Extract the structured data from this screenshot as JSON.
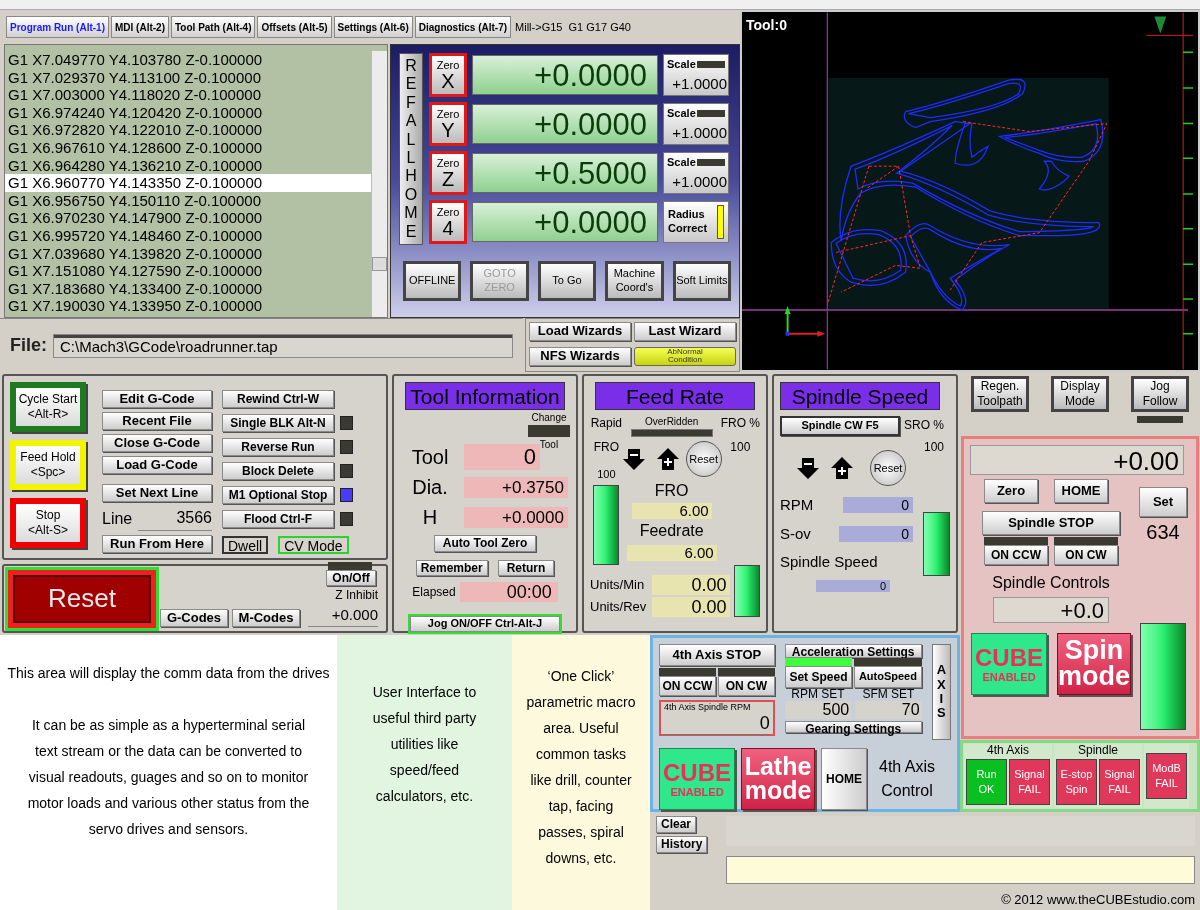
{
  "tabs": [
    {
      "label": "Program Run (Alt-1)",
      "selected": true
    },
    {
      "label": "MDI (Alt-2)",
      "selected": false
    },
    {
      "label": "Tool Path (Alt-4)",
      "selected": false
    },
    {
      "label": "Offsets (Alt-5)",
      "selected": false
    },
    {
      "label": "Settings (Alt-6)",
      "selected": false
    },
    {
      "label": "Diagnostics (Alt-7)",
      "selected": false
    }
  ],
  "modal_status": "Mill->G15  G1 G17 G40",
  "gcode": {
    "lines": [
      {
        "text": "G1 X7.049770 Y4.103780 Z-0.100000",
        "selected": false
      },
      {
        "text": "G1 X7.029370 Y4.113100 Z-0.100000",
        "selected": false
      },
      {
        "text": "G1 X7.003000 Y4.118020 Z-0.100000",
        "selected": false
      },
      {
        "text": "G1 X6.974240 Y4.120420 Z-0.100000",
        "selected": false
      },
      {
        "text": "G1 X6.972820 Y4.122010 Z-0.100000",
        "selected": false
      },
      {
        "text": "G1 X6.967610 Y4.128600 Z-0.100000",
        "selected": false
      },
      {
        "text": "G1 X6.964280 Y4.136210 Z-0.100000",
        "selected": false
      },
      {
        "text": "G1 X6.960770 Y4.143350 Z-0.100000",
        "selected": true
      },
      {
        "text": "G1 X6.956750 Y4.150110 Z-0.100000",
        "selected": false
      },
      {
        "text": "G1 X6.970230 Y4.147900 Z-0.100000",
        "selected": false
      },
      {
        "text": "G1 X6.995720 Y4.148460 Z-0.100000",
        "selected": false
      },
      {
        "text": "G1 X7.039680 Y4.139820 Z-0.100000",
        "selected": false
      },
      {
        "text": "G1 X7.151080 Y4.127590 Z-0.100000",
        "selected": false
      },
      {
        "text": "G1 X7.183680 Y4.133400 Z-0.100000",
        "selected": false
      },
      {
        "text": "G1 X7.190030 Y4.133950 Z-0.100000",
        "selected": false
      }
    ]
  },
  "dro": {
    "ref_label": "REF ALL HOME",
    "axes": [
      {
        "zero": "Zero",
        "axis": "X",
        "value": "+0.0000",
        "side": {
          "kind": "scale",
          "label": "Scale",
          "value": "+1.0000",
          "on": false
        }
      },
      {
        "zero": "Zero",
        "axis": "Y",
        "value": "+0.0000",
        "side": {
          "kind": "scale",
          "label": "Scale",
          "value": "+1.0000",
          "on": false
        }
      },
      {
        "zero": "Zero",
        "axis": "Z",
        "value": "+0.5000",
        "side": {
          "kind": "scale",
          "label": "Scale",
          "value": "+1.0000",
          "on": false
        }
      },
      {
        "zero": "Zero",
        "axis": "4",
        "value": "+0.0000",
        "side": {
          "kind": "toggle",
          "label": "Radius Correct",
          "on": true
        }
      }
    ],
    "buttons": [
      {
        "label": "OFFLINE",
        "disabled": false
      },
      {
        "label": "GOTO ZERO",
        "disabled": true
      },
      {
        "label": "To Go",
        "disabled": false
      },
      {
        "label": "Machine Coord's",
        "disabled": false
      },
      {
        "label": "Soft Limits",
        "disabled": false
      }
    ]
  },
  "file": {
    "label": "File:",
    "path": "C:\\Mach3\\GCode\\roadrunner.tap"
  },
  "wizards": [
    {
      "kind": "button",
      "label": "Load Wizards"
    },
    {
      "kind": "button",
      "label": "Last Wizard"
    },
    {
      "kind": "button",
      "label": "NFS Wizards"
    },
    {
      "kind": "alarm",
      "label": "AbNormal Condition"
    }
  ],
  "toolpath": {
    "label": "Tool:0"
  },
  "cycle_buttons": [
    {
      "label": "Cycle Start\n<Alt-R>",
      "color": "#1e7a1e"
    },
    {
      "label": "Feed Hold\n<Spc>",
      "color": "#f4f400"
    },
    {
      "label": "Stop\n<Alt-S>",
      "color": "#f00000"
    }
  ],
  "file_buttons": [
    "Edit G-Code",
    "Recent File",
    "Close G-Code",
    "Load G-Code",
    "Set Next Line"
  ],
  "line": {
    "label": "Line",
    "value": "3566"
  },
  "run_from_here": "Run From Here",
  "toggles": [
    {
      "kind": "plain",
      "label": "Rewind Ctrl-W"
    },
    {
      "kind": "led",
      "label": "Single BLK Alt-N",
      "on": false
    },
    {
      "kind": "led",
      "label": "Reverse Run",
      "on": false
    },
    {
      "kind": "led",
      "label": "Block Delete",
      "on": false
    },
    {
      "kind": "led",
      "label": "M1 Optional Stop",
      "on": true
    },
    {
      "kind": "led",
      "label": "Flood Ctrl-F",
      "on": false
    }
  ],
  "modes": [
    {
      "label": "Dwell",
      "on": false
    },
    {
      "label": "CV Mode",
      "on": true
    }
  ],
  "reset": {
    "label": "Reset"
  },
  "code_lists": [
    "G-Codes",
    "M-Codes"
  ],
  "z_inhibit": {
    "button": "On/Off",
    "on": false,
    "label": "Z Inhibit",
    "value": "+0.000"
  },
  "tool_info": {
    "title": "Tool Information",
    "change_top": "Change",
    "change_bottom": "Tool",
    "change_on": false,
    "fields": [
      {
        "label": "Tool",
        "value": "0"
      },
      {
        "label": "Dia.",
        "value": "+0.3750"
      },
      {
        "label": "H",
        "value": "+0.0000"
      }
    ],
    "auto_zero": "Auto Tool Zero",
    "remember": "Remember",
    "return": "Return",
    "elapsed_label": "Elapsed",
    "elapsed": "00:00",
    "jog": "Jog ON/OFF Ctrl-Alt-J"
  },
  "feed_rate": {
    "title": "Feed Rate",
    "rapid": "Rapid",
    "fro_small": "FRO",
    "overridden": "OverRidden",
    "overridden_on": false,
    "fro_pct_label": "FRO %",
    "fro_pct": "100",
    "slider_label": "100",
    "reset": "Reset",
    "fro_label": "FRO",
    "fro_value": "6.00",
    "feedrate_label": "Feedrate",
    "feedrate_value": "6.00",
    "units_min_label": "Units/Min",
    "units_min": "0.00",
    "units_rev_label": "Units/Rev",
    "units_rev": "0.00"
  },
  "spindle_speed": {
    "title": "Spindle Speed",
    "cw_button": "Spindle CW F5",
    "sro_label": "SRO %",
    "sro": "100",
    "reset": "Reset",
    "rpm_label": "RPM",
    "rpm": "0",
    "sov_label": "S-ov",
    "sov": "0",
    "speed_label": "Spindle Speed",
    "speed": "0"
  },
  "view_buttons": [
    "Regen.\nToolpath",
    "Display\nMode",
    "Jog\nFollow"
  ],
  "jog_follow_on": false,
  "spindle_controls": {
    "dro": "+0.00",
    "zero": "Zero",
    "home": "HOME",
    "set": "Set",
    "set_value": "634",
    "stop": "Spindle STOP",
    "directions": [
      {
        "label": "ON CCW",
        "on": false
      },
      {
        "label": "ON CW",
        "on": false
      }
    ],
    "title": "Spindle Controls",
    "override": "+0.0",
    "cube": {
      "top": "CUBE",
      "bottom": "ENABLED"
    },
    "spin_mode": "Spin\nmode"
  },
  "info_areas": [
    {
      "kind": "drives",
      "heading": "This area will display the comm data from the drives",
      "body": "It can be as simple as a hyperterminal serial text stream or the data can be converted to visual readouts, guages and so on to monitor motor loads and various other status from the servo drives and sensors."
    },
    {
      "kind": "utilities",
      "body": "User Interface to useful third party utilities like speed/feed calculators, etc."
    },
    {
      "kind": "macros",
      "body": "‘One Click’ parametric macro area. Useful common tasks like drill, counter tap, facing passes, spiral downs, etc."
    }
  ],
  "fourth_axis": {
    "stop": "4th Axis  STOP",
    "directions": [
      {
        "label": "ON CCW",
        "on": false
      },
      {
        "label": "ON CW",
        "on": false
      }
    ],
    "rpm_label": "4th Axis Spindle RPM",
    "rpm": "0",
    "accel": "Acceleration Settings",
    "accel_leds": [
      {
        "on": true
      },
      {
        "on": false
      }
    ],
    "set_speed": "Set Speed",
    "auto_speed": "AutoSpeed",
    "rpm_set_label": "RPM SET",
    "rpm_set": "500",
    "sfm_set_label": "SFM SET",
    "sfm_set": "70",
    "gearing": "Gearing Settings",
    "axis_button": "AXIS",
    "cube": {
      "top": "CUBE",
      "bottom": "ENABLED"
    },
    "lathe_mode": "Lathe\nmode",
    "home": "HOME",
    "title": "4th Axis\nControl"
  },
  "status_groups": [
    {
      "title": "4th Axis",
      "signals": [
        {
          "label": "Run\nOK",
          "ok": true
        },
        {
          "label": "Signal\nFAIL",
          "ok": false
        }
      ]
    },
    {
      "title": "Spindle",
      "signals": [
        {
          "label": "E-stop\nSpin",
          "ok": false
        },
        {
          "label": "Signal\nFAIL",
          "ok": false
        }
      ]
    },
    {
      "signals": [
        {
          "label": "ModB\nFAIL",
          "ok": false
        }
      ]
    }
  ],
  "message_buttons": [
    "Clear",
    "History"
  ],
  "copyright": "© 2012 www.theCUBEstudio.com"
}
